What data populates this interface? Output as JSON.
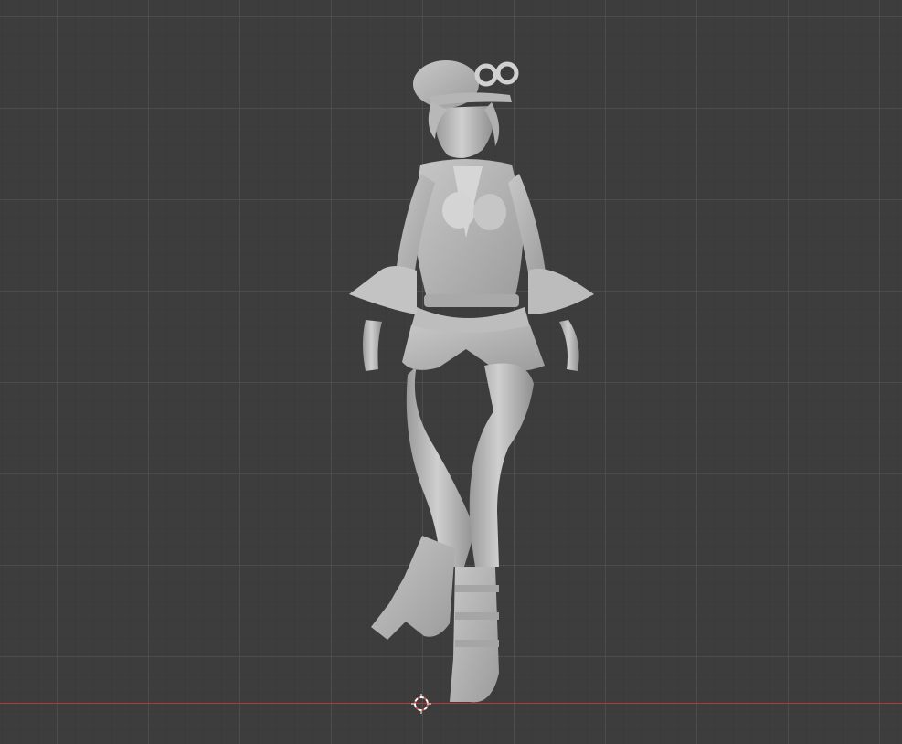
{
  "viewport": {
    "background_color": "#3d3d3d",
    "grid_major_color": "#5a5a5a",
    "grid_minor_color": "#3a3a3a",
    "x_axis_color": "#b33a3a",
    "model_color": "#bdbdbd"
  },
  "scene": {
    "object": "sculpted-figure-model",
    "cursor": "3d-cursor-icon"
  }
}
